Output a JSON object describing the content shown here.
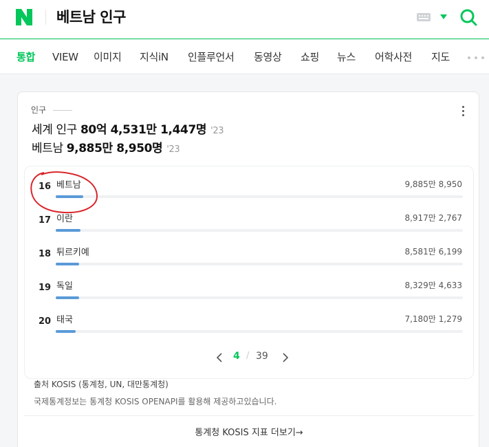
{
  "header": {
    "query": "베트남 인구",
    "colors": {
      "brand": "#03c75a"
    }
  },
  "tabs": [
    "통합",
    "VIEW",
    "이미지",
    "지식iN",
    "인플루언서",
    "동영상",
    "쇼핑",
    "뉴스",
    "어학사전",
    "지도"
  ],
  "card": {
    "label": "인구",
    "world": {
      "prefix": "세계 인구",
      "value": "80억 4,531만 1,447명",
      "year": "'23"
    },
    "country": {
      "prefix": "베트남",
      "value": "9,885만 8,950명",
      "year": "'23"
    },
    "rankings": [
      {
        "rank": "16",
        "name": "베트남",
        "value": "9,885만 8,950",
        "fill": 0.067
      },
      {
        "rank": "17",
        "name": "이란",
        "value": "8,917만 2,767",
        "fill": 0.06
      },
      {
        "rank": "18",
        "name": "튀르키예",
        "value": "8,581만 6,199",
        "fill": 0.058
      },
      {
        "rank": "19",
        "name": "독일",
        "value": "8,329만 4,633",
        "fill": 0.057
      },
      {
        "rank": "20",
        "name": "태국",
        "value": "7,180만 1,279",
        "fill": 0.049
      }
    ],
    "pager": {
      "current": "4",
      "separator": "/",
      "total": "39"
    },
    "source": "출처 KOSIS (통계청, UN, 대만통계청)",
    "source_note": "국제통계정보는 통계청 KOSIS OPENAPI를 활용해 제공하고있습니다.",
    "more_link": "통계청 KOSIS 지표 더보기",
    "more_arrow": "→"
  }
}
